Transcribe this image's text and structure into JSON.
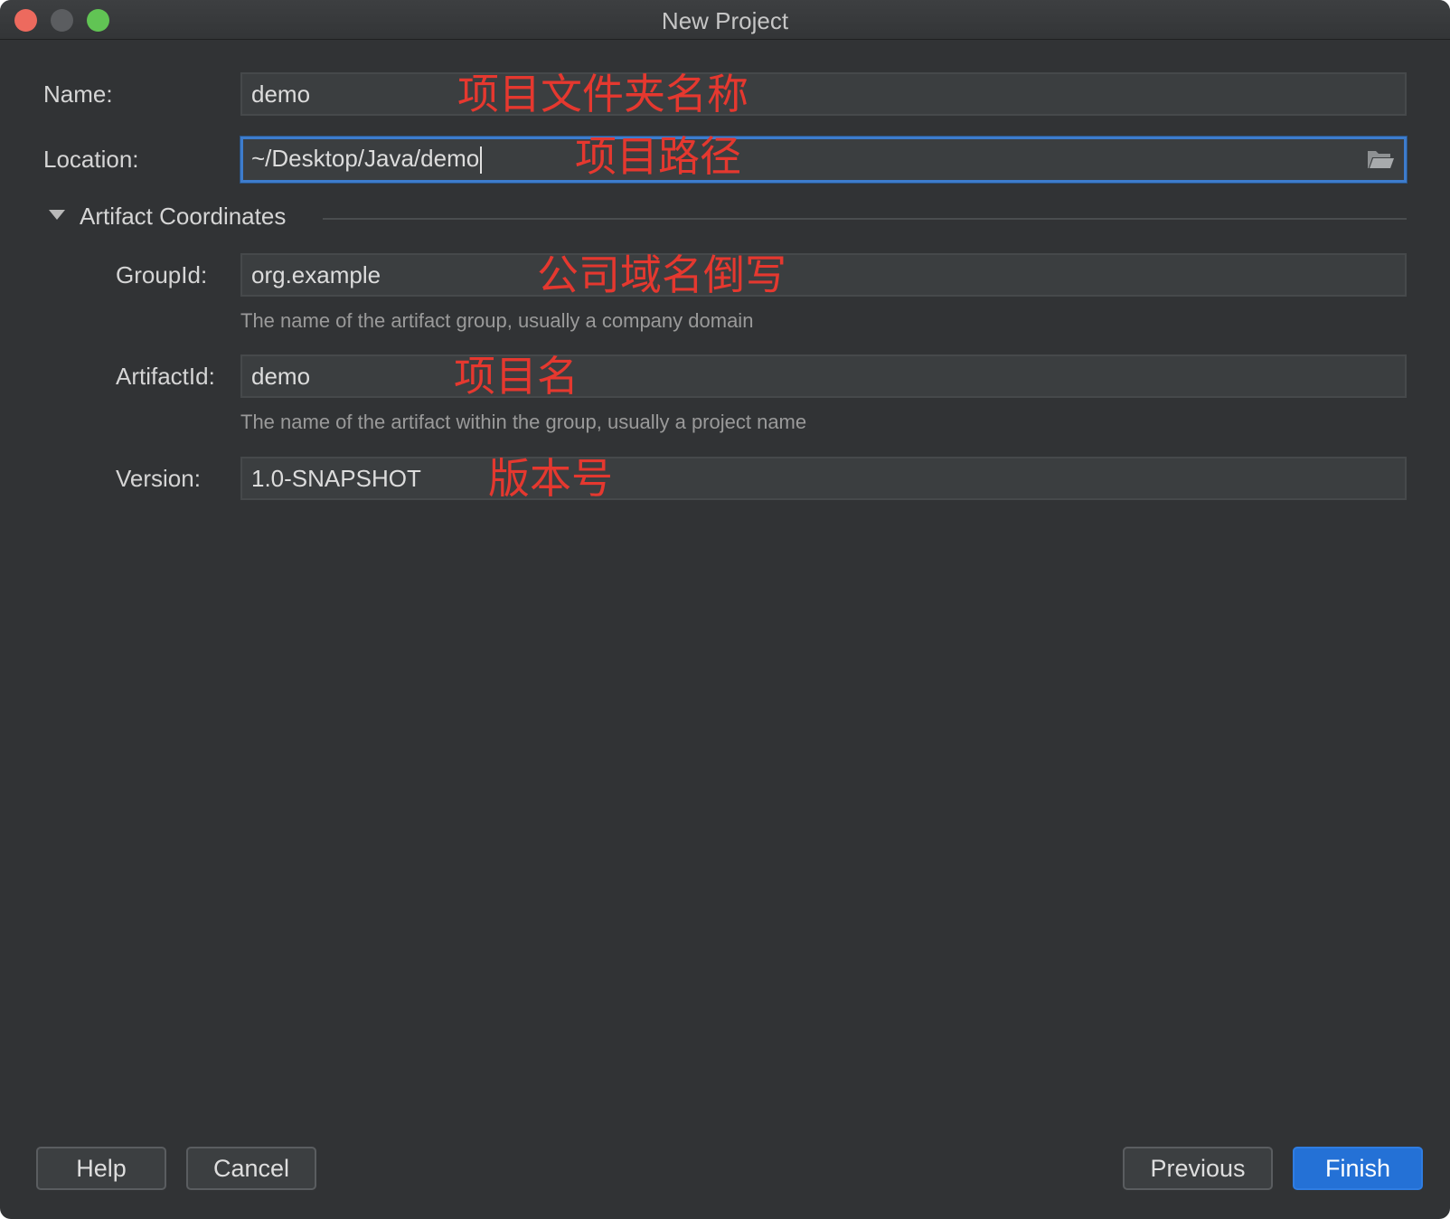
{
  "window": {
    "title": "New Project"
  },
  "form": {
    "name": {
      "label": "Name:",
      "value": "demo"
    },
    "location": {
      "label": "Location:",
      "value": "~/Desktop/Java/demo"
    },
    "section": {
      "title": "Artifact Coordinates"
    },
    "group_id": {
      "label": "GroupId:",
      "value": "org.example",
      "hint": "The name of the artifact group, usually a company domain"
    },
    "artifact_id": {
      "label": "ArtifactId:",
      "value": "demo",
      "hint": "The name of the artifact within the group, usually a project name"
    },
    "version": {
      "label": "Version:",
      "value": "1.0-SNAPSHOT"
    }
  },
  "annotations": {
    "name": "项目文件夹名称",
    "location": "项目路径",
    "group_id": "公司域名倒写",
    "artifact_id": "项目名",
    "version": "版本号"
  },
  "buttons": {
    "help": "Help",
    "cancel": "Cancel",
    "previous": "Previous",
    "finish": "Finish"
  },
  "colors": {
    "background": "#313335",
    "accent": "#2471d6",
    "annotation": "#e5382f"
  }
}
